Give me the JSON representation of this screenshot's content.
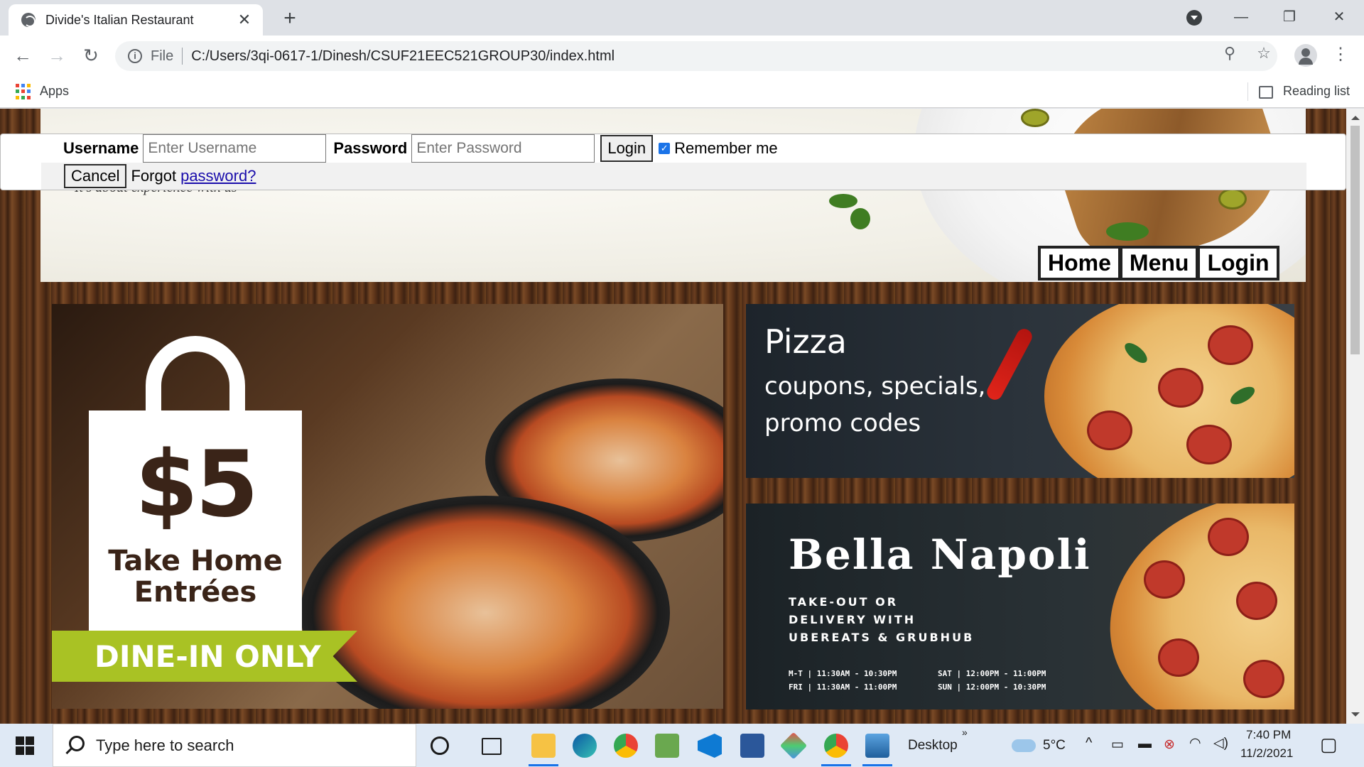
{
  "browser": {
    "tab_title": "Divide's Italian Restaurant",
    "url_scheme": "File",
    "url": "C:/Users/3qi-0617-1/Dinesh/CSUF21EEC521GROUP30/index.html",
    "bookmarks_apps": "Apps",
    "reading_list": "Reading list",
    "icons": {
      "back": "back-arrow-icon",
      "forward": "forward-arrow-icon",
      "reload": "reload-icon",
      "zoom": "zoom-icon",
      "bookmark": "star-icon",
      "profile": "profile-icon",
      "menu": "kebab-menu-icon"
    }
  },
  "login": {
    "username_label": "Username",
    "username_placeholder": "Enter Username",
    "password_label": "Password",
    "password_placeholder": "Enter Password",
    "login_button": "Login",
    "remember_label": "Remember me",
    "remember_checked": true,
    "cancel_button": "Cancel",
    "forgot_text": "Forgot",
    "forgot_link": "password?"
  },
  "header": {
    "tagline": "It's about experience with us"
  },
  "nav": {
    "items": [
      "Home",
      "Menu",
      "Login"
    ]
  },
  "promos": {
    "takehome": {
      "price": "$5",
      "line1": "Take Home",
      "line2": "Entrées",
      "ribbon": "DINE-IN ONLY"
    },
    "pizza": {
      "title": "Pizza",
      "line1": "coupons, specials,",
      "line2": "promo codes"
    },
    "napoli": {
      "title": "Bella Napoli",
      "line1": "TAKE-OUT OR",
      "line2": "DELIVERY WITH",
      "line3": "UBEREATS & GRUBHUB",
      "hours1": "M-T | 11:30AM - 10:30PM",
      "hours2": "FRI | 11:30AM - 11:00PM",
      "hours3": "SAT | 12:00PM - 11:00PM",
      "hours4": "SUN | 12:00PM - 10:30PM"
    }
  },
  "taskbar": {
    "search_placeholder": "Type here to search",
    "desktop_label": "Desktop",
    "temperature": "5°C",
    "time": "7:40 PM",
    "date": "11/2/2021"
  },
  "colors": {
    "link": "#1a0dab",
    "checkbox": "#1a73e8",
    "ribbon": "#a9c224"
  }
}
